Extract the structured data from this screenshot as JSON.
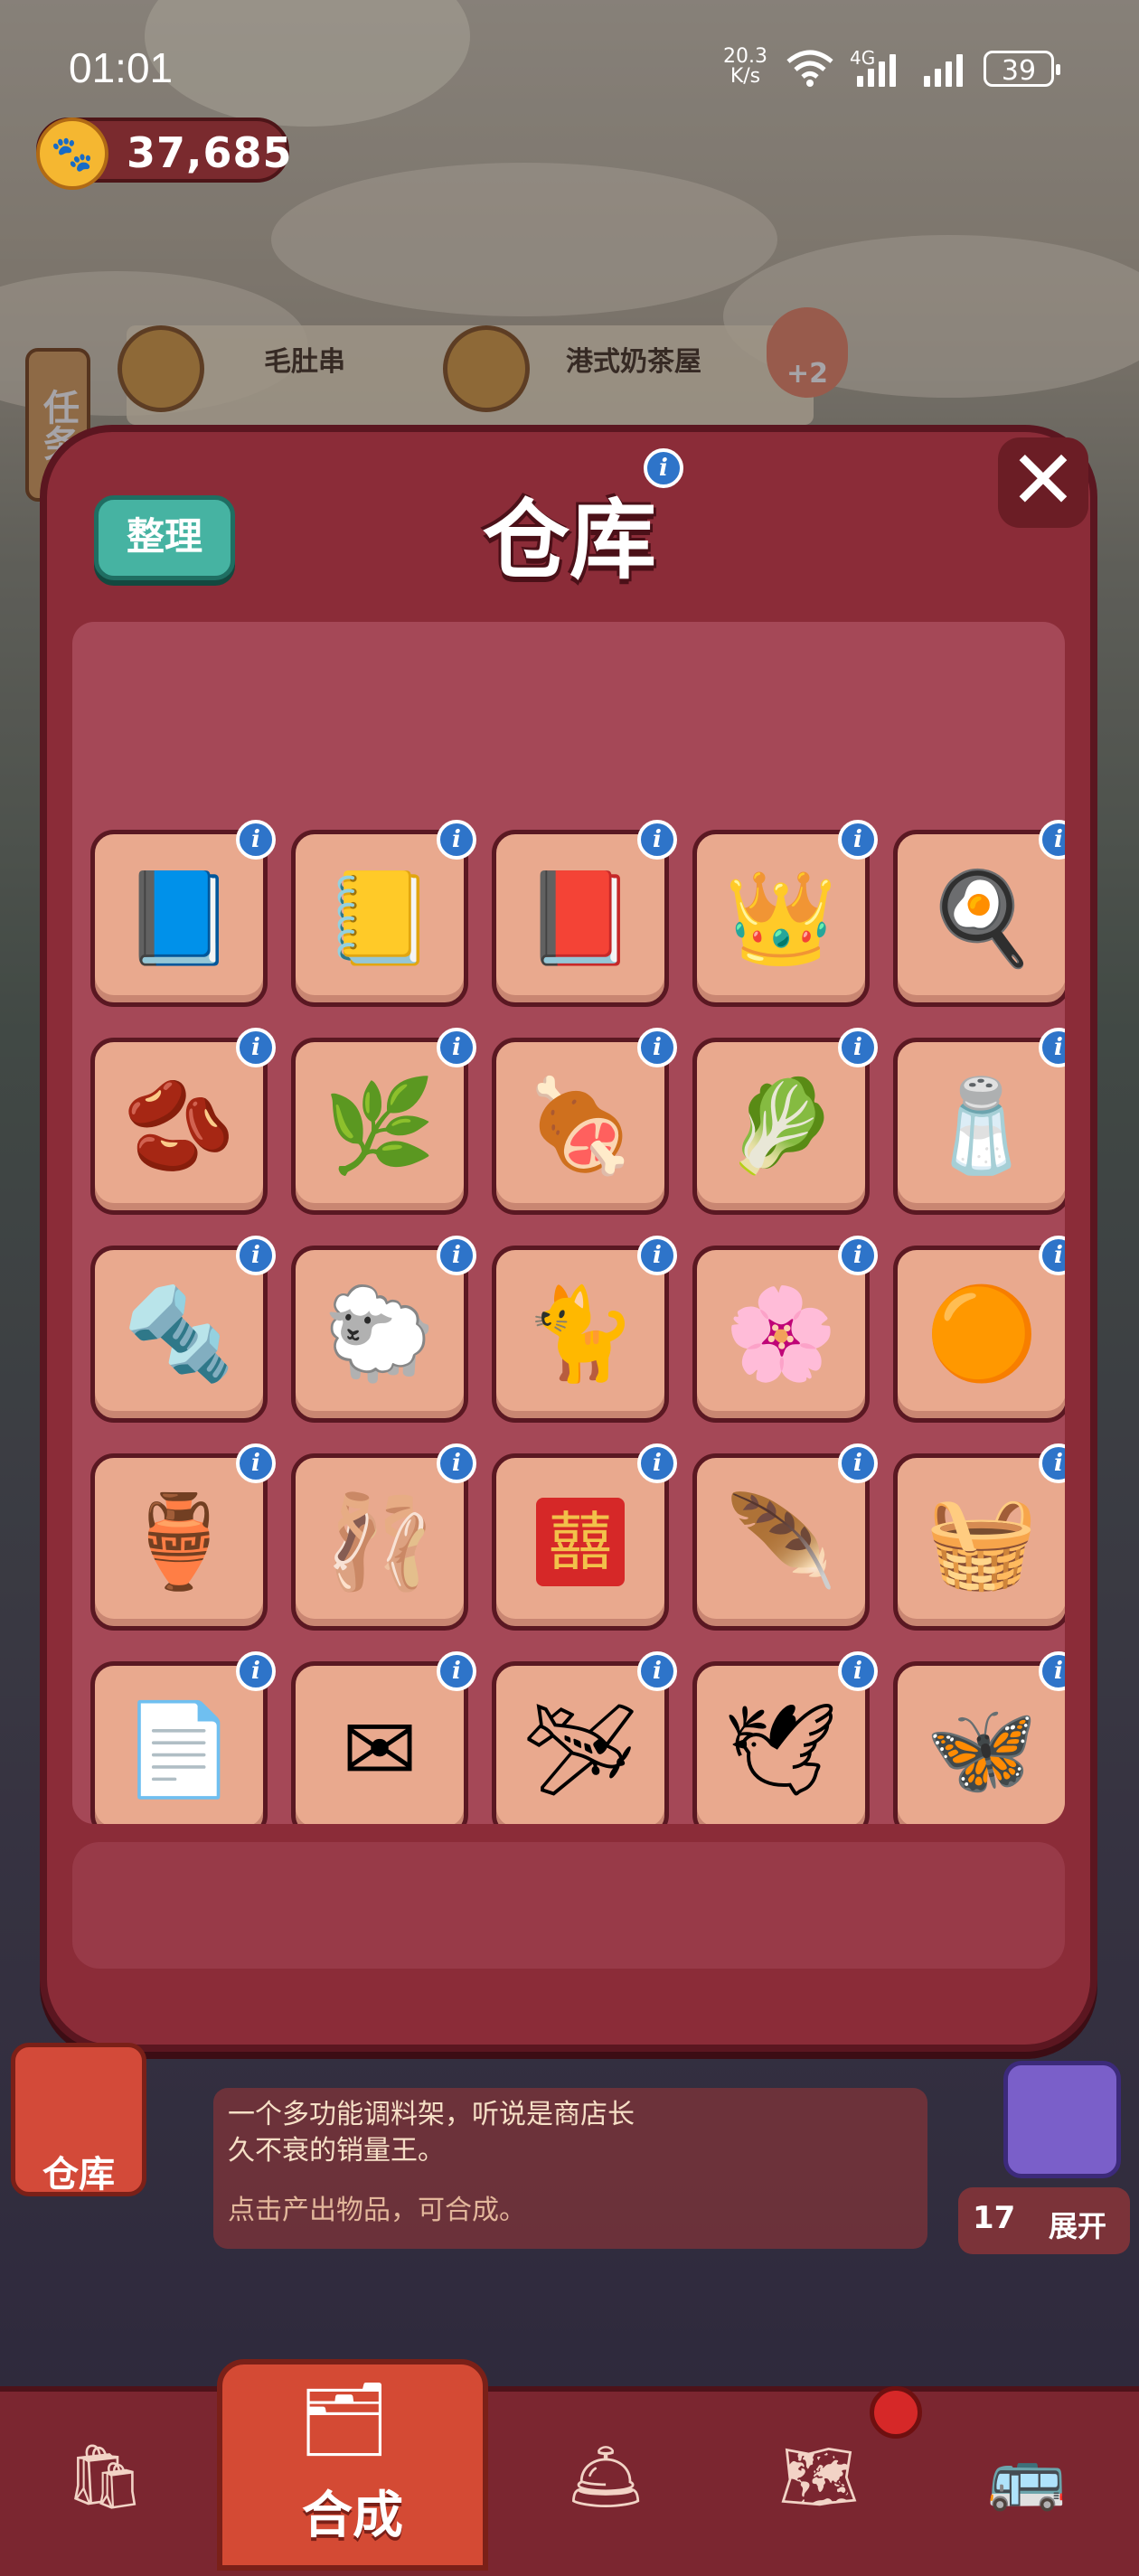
{
  "status_bar": {
    "time": "01:01",
    "net_speed_value": "20.3",
    "net_speed_unit": "K/s",
    "network_type": "4G",
    "battery": "39"
  },
  "currency": {
    "amount": "37,685",
    "icon": "paw-icon"
  },
  "background": {
    "side_tab": "任务",
    "task_items": [
      {
        "label": "毛肚串",
        "icon": "skewer-icon"
      },
      {
        "label": "港式奶茶屋",
        "icon": "roller-icon"
      }
    ],
    "bonus_badge": "+2"
  },
  "modal": {
    "title": "仓库",
    "sort_label": "整理",
    "close_label": "✕",
    "items": [
      {
        "name": "sun-notebook",
        "glyph": "📘"
      },
      {
        "name": "bear-notebook",
        "glyph": "📒"
      },
      {
        "name": "star-book",
        "glyph": "📕"
      },
      {
        "name": "golden-chef-hat",
        "glyph": "👑"
      },
      {
        "name": "pea-dish",
        "glyph": "🍳"
      },
      {
        "name": "beans-on-paper",
        "glyph": "🫘"
      },
      {
        "name": "herbs-board",
        "glyph": "🌿"
      },
      {
        "name": "minced-meat-plate",
        "glyph": "🍖"
      },
      {
        "name": "greens-board",
        "glyph": "🥬"
      },
      {
        "name": "salt-pile",
        "glyph": "🧂"
      },
      {
        "name": "rolling-pin",
        "glyph": "🔩"
      },
      {
        "name": "sheep",
        "glyph": "🐑"
      },
      {
        "name": "jade-cat",
        "glyph": "🐈"
      },
      {
        "name": "flower-wreath",
        "glyph": "🌸"
      },
      {
        "name": "amber-drop",
        "glyph": "🟠"
      },
      {
        "name": "porcelain-charm",
        "glyph": "🏺"
      },
      {
        "name": "dancer-music-box",
        "glyph": "🩰"
      },
      {
        "name": "double-happiness",
        "glyph": "囍"
      },
      {
        "name": "dreamcatcher",
        "glyph": "🪶"
      },
      {
        "name": "spice-rack",
        "glyph": "🧺"
      },
      {
        "name": "crumpled-paper",
        "glyph": "📄"
      },
      {
        "name": "paper-envelope",
        "glyph": "✉"
      },
      {
        "name": "paper-plane",
        "glyph": "🛩"
      },
      {
        "name": "paper-crane",
        "glyph": "🕊"
      },
      {
        "name": "purple-butterfly",
        "glyph": "🦋"
      },
      {
        "name": "tea-leaves-dish",
        "glyph": "🍂"
      },
      {
        "name": "tea-leaves-mat",
        "glyph": "🍃"
      },
      {
        "name": "tea-bowl",
        "glyph": "🍵"
      },
      {
        "name": "paper-umbrella",
        "glyph": "☂"
      },
      {
        "name": "tea-basket",
        "glyph": "🧺"
      },
      {
        "name": "scroll",
        "glyph": "📜"
      },
      {
        "name": "bow",
        "glyph": "🎀"
      },
      {
        "name": "brush",
        "glyph": "🖌"
      },
      {
        "name": "paper-item",
        "glyph": "📄"
      },
      {
        "name": "round-dish",
        "glyph": "🍽"
      }
    ]
  },
  "detail": {
    "description": "一个多功能调料架，听说是商店长久不衰的销量王。",
    "hint": "点击产出物品，可合成。",
    "warehouse_label": "仓库",
    "expand_count": "17",
    "expand_label": "展开"
  },
  "bottom_nav": {
    "active_label": "合成",
    "items": [
      {
        "name": "shop",
        "icon": "shopping-bag-icon",
        "glyph": "🛍"
      },
      {
        "name": "merge",
        "icon": "merge-icon",
        "glyph": "🗂"
      },
      {
        "name": "service",
        "icon": "bell-cloche-icon",
        "glyph": "🛎"
      },
      {
        "name": "map",
        "icon": "map-pin-icon",
        "glyph": "🗺"
      },
      {
        "name": "bus",
        "icon": "bus-icon",
        "glyph": "🚌"
      }
    ]
  }
}
